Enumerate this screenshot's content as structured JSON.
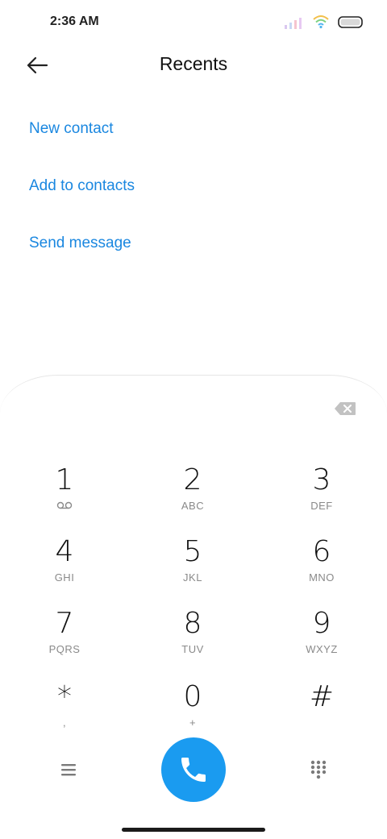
{
  "status_bar": {
    "time": "2:36 AM",
    "icons": [
      "signal-icon",
      "wifi-icon",
      "battery-icon"
    ]
  },
  "header": {
    "title": "Recents",
    "back_icon": "arrow-left-icon"
  },
  "actions": [
    {
      "label": "New contact"
    },
    {
      "label": "Add to contacts"
    },
    {
      "label": "Send message"
    }
  ],
  "dialpad": {
    "backspace_icon": "backspace-icon",
    "keys": [
      {
        "digit": "1",
        "letters": "",
        "icon": "voicemail-icon"
      },
      {
        "digit": "2",
        "letters": "ABC"
      },
      {
        "digit": "3",
        "letters": "DEF"
      },
      {
        "digit": "4",
        "letters": "GHI"
      },
      {
        "digit": "5",
        "letters": "JKL"
      },
      {
        "digit": "6",
        "letters": "MNO"
      },
      {
        "digit": "7",
        "letters": "PQRS"
      },
      {
        "digit": "8",
        "letters": "TUV"
      },
      {
        "digit": "9",
        "letters": "WXYZ"
      },
      {
        "digit": "*",
        "letters": ","
      },
      {
        "digit": "0",
        "letters": "+"
      },
      {
        "digit": "#",
        "letters": ""
      }
    ]
  },
  "bottom_bar": {
    "menu_icon": "menu-icon",
    "call_icon": "phone-icon",
    "dialpad_icon": "dialpad-grid-icon"
  },
  "colors": {
    "accent": "#1a87e0",
    "call_button": "#1a9bf0",
    "letters": "#8a8a8a"
  }
}
